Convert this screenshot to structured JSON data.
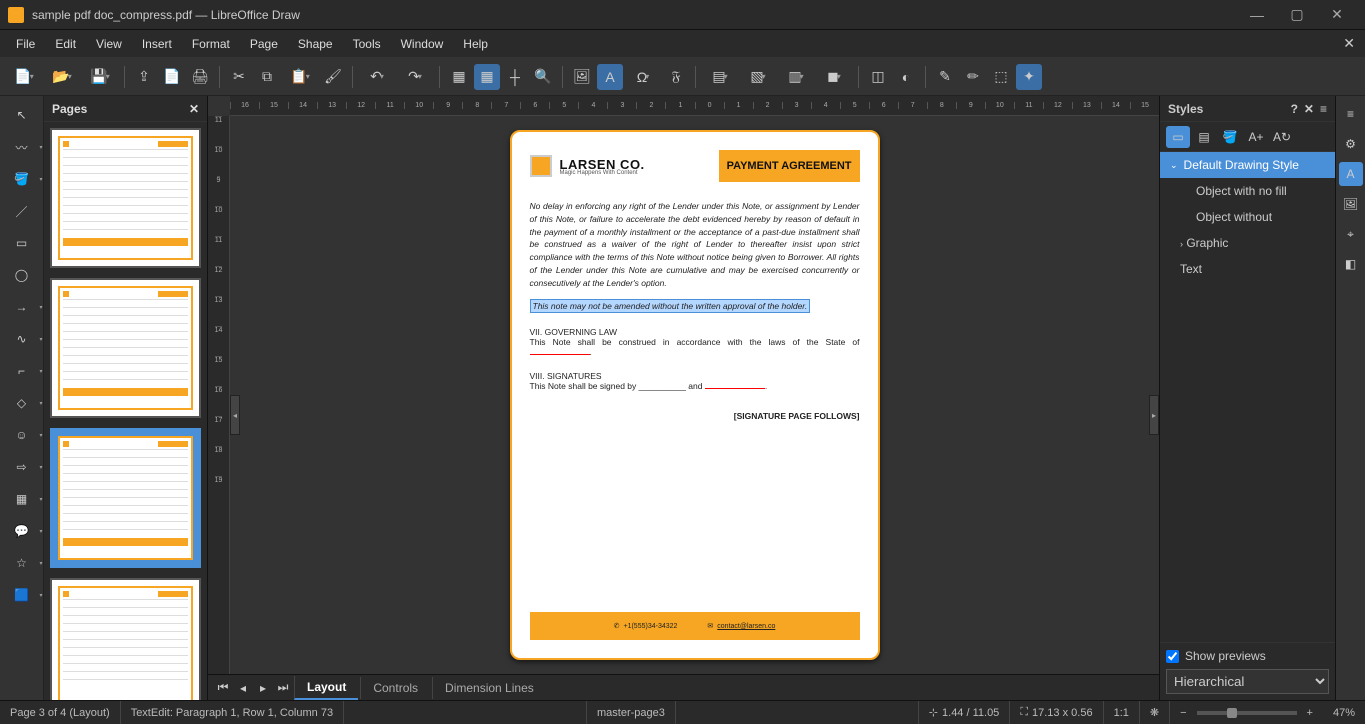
{
  "window": {
    "title": "sample pdf doc_compress.pdf — LibreOffice Draw"
  },
  "menu": [
    "File",
    "Edit",
    "View",
    "Insert",
    "Format",
    "Page",
    "Shape",
    "Tools",
    "Window",
    "Help"
  ],
  "pages_panel": {
    "title": "Pages"
  },
  "pages": [
    1,
    2,
    3,
    4
  ],
  "selected_page_index": 2,
  "document": {
    "company": "LARSEN CO.",
    "tagline": "Magic Happens With Content",
    "badge": "PAYMENT AGREEMENT",
    "paragraph": "No delay in enforcing any right of the Lender under this Note, or assignment by Lender of this Note, or failure to accelerate the debt evidenced hereby by reason of default in the payment of a monthly installment or the acceptance of a past-due installment shall be construed as a waiver of the right of Lender to thereafter insist upon strict compliance with the terms of this Note without notice being given to Borrower. All rights of the Lender under this Note are cumulative and may be exercised concurrently or consecutively at the Lender's option.",
    "highlight": "This note may not be amended without the written approval of the holder.",
    "sec7_title": "VII. GOVERNING LAW",
    "sec7_body": "This Note shall be construed in accordance with the laws of the State of",
    "sec8_title": "VIII. SIGNATURES",
    "sec8_body_a": "This Note shall be signed by",
    "sec8_body_b": "and",
    "sig_follows": "[SIGNATURE PAGE FOLLOWS]",
    "phone": "+1(555)34-34322",
    "email": "contact@larsen.co"
  },
  "tabs": [
    "Layout",
    "Controls",
    "Dimension Lines"
  ],
  "active_tab": 0,
  "styles": {
    "title": "Styles",
    "items": [
      "Default Drawing Style",
      "Object with no fill",
      "Object without",
      "Graphic",
      "Text"
    ],
    "show_previews": "Show previews",
    "show_previews_checked": true,
    "mode": "Hierarchical"
  },
  "status": {
    "page": "Page 3 of 4 (Layout)",
    "edit": "TextEdit: Paragraph 1, Row 1, Column 73",
    "master": "master-page3",
    "pos": "1.44 / 11.05",
    "size": "17.13 x 0.56",
    "scale": "1:1",
    "zoom": "47%"
  }
}
